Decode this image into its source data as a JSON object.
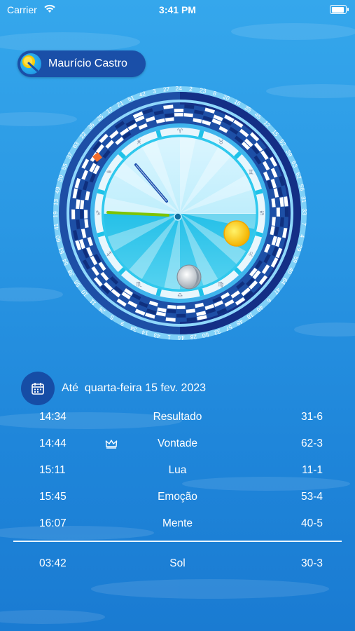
{
  "status": {
    "carrier": "Carrier",
    "time": "3:41 PM"
  },
  "user": {
    "name": "Maurício Castro"
  },
  "wheel": {
    "numbers": [
      "2",
      "23",
      "8",
      "20",
      "16",
      "35",
      "45",
      "12",
      "15",
      "52",
      "39",
      "53",
      "62",
      "56",
      "31",
      "33",
      "7",
      "4",
      "29",
      "59",
      "40",
      "64",
      "47",
      "6",
      "46",
      "18",
      "48",
      "57",
      "32",
      "50",
      "28",
      "44",
      "1",
      "43",
      "14",
      "34",
      "9",
      "5",
      "26",
      "11",
      "10",
      "58",
      "38",
      "54",
      "61",
      "60",
      "41",
      "19",
      "13",
      "49",
      "30",
      "55",
      "37",
      "63",
      "22",
      "36",
      "25",
      "17",
      "21",
      "51",
      "42",
      "3",
      "27",
      "24"
    ]
  },
  "date": {
    "prefix": "Até",
    "label": "quarta-feira 15 fev. 2023"
  },
  "transits": [
    {
      "time": "14:34",
      "label": "Resultado",
      "value": "31-6",
      "crown": false
    },
    {
      "time": "14:44",
      "label": "Vontade",
      "value": "62-3",
      "crown": true
    },
    {
      "time": "15:11",
      "label": "Lua",
      "value": "11-1",
      "crown": false
    },
    {
      "time": "15:45",
      "label": "Emoção",
      "value": "53-4",
      "crown": false
    },
    {
      "time": "16:07",
      "label": "Mente",
      "value": "40-5",
      "crown": false
    }
  ],
  "sun_row": {
    "time": "03:42",
    "label": "Sol",
    "value": "30-3"
  }
}
